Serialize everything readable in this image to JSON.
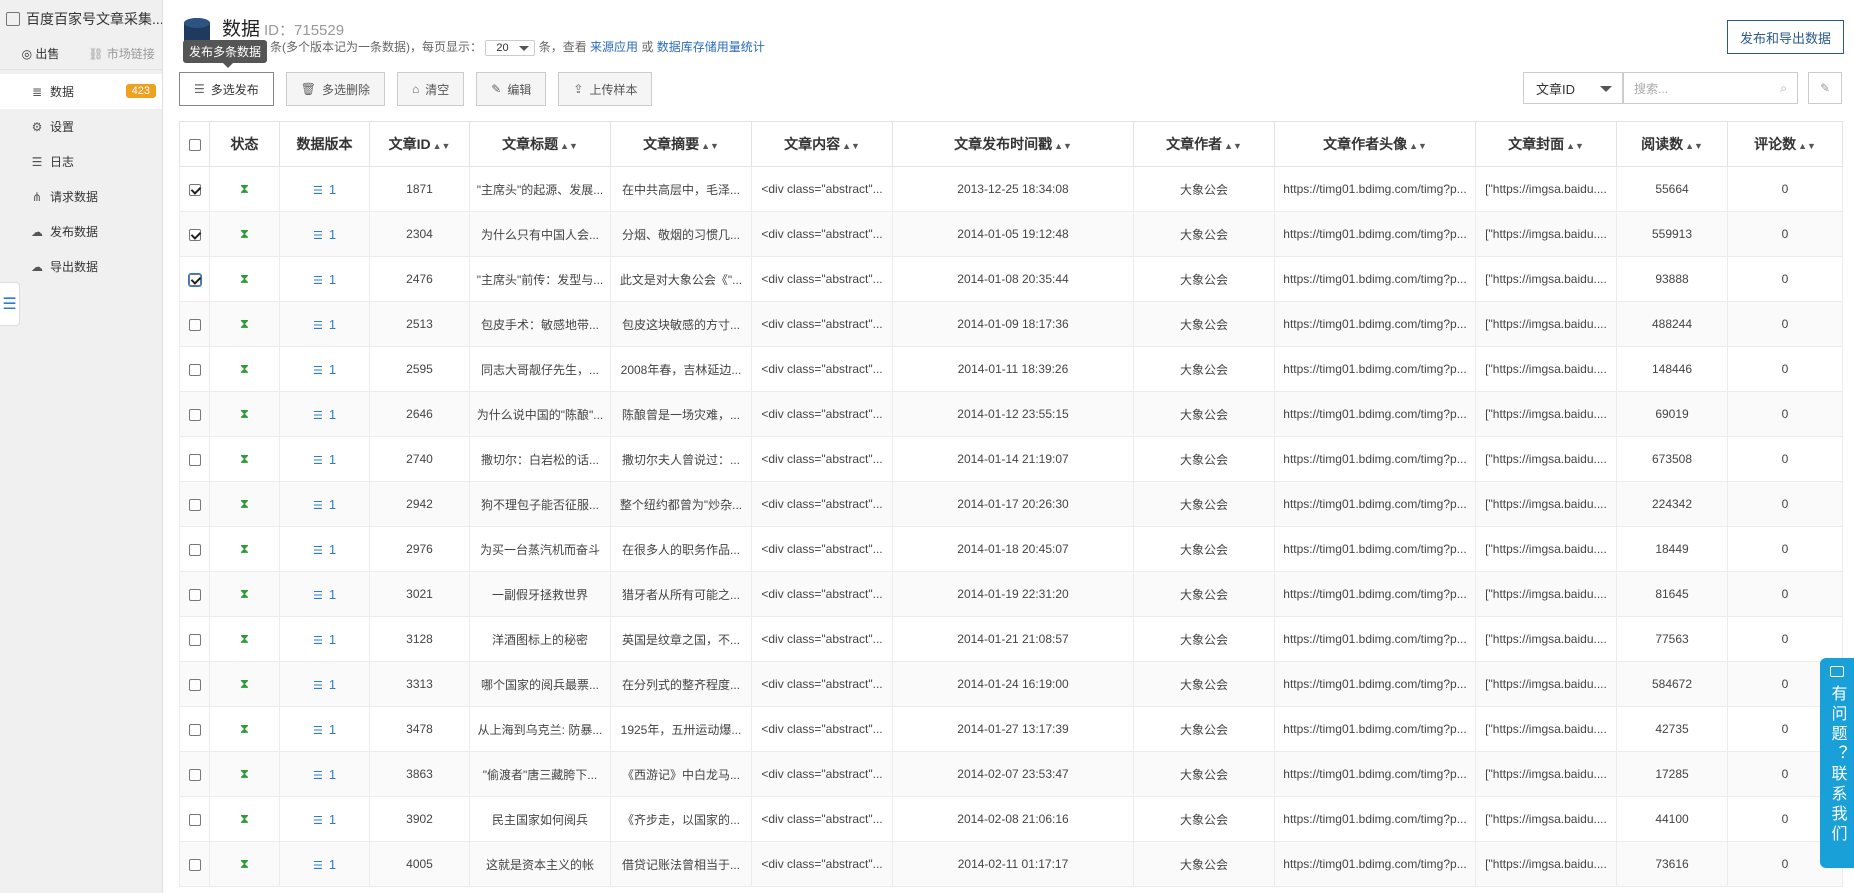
{
  "app": {
    "title": "百度百家号文章采集..."
  },
  "sidebar": {
    "tabs": [
      {
        "label": "出售"
      },
      {
        "label": "市场链接"
      }
    ],
    "items": [
      {
        "label": "数据",
        "icon": "database-icon",
        "badge": "423"
      },
      {
        "label": "设置",
        "icon": "gear-icon"
      },
      {
        "label": "日志",
        "icon": "list-icon"
      },
      {
        "label": "请求数据",
        "icon": "share-icon"
      },
      {
        "label": "发布数据",
        "icon": "cloud-upload-icon"
      },
      {
        "label": "导出数据",
        "icon": "cloud-download-icon"
      }
    ]
  },
  "header": {
    "title": "数据",
    "id_text": "ID：715529",
    "sub_prefix": "条(多个版本记为一条数据)，每页显示：",
    "page_size": "20",
    "sub_middle": "条，查看",
    "link_source": "来源应用",
    "sub_or": "或",
    "link_stats": "数据库存储用量统计",
    "tooltip": "发布多条数据",
    "publish_export": "发布和导出数据"
  },
  "toolbar": {
    "multi_publish": "多选发布",
    "multi_delete": "多选删除",
    "clear": "清空",
    "edit": "编辑",
    "upload_sample": "上传样本"
  },
  "search": {
    "field": "文章ID",
    "placeholder": "搜索..."
  },
  "table": {
    "columns": [
      "状态",
      "数据版本",
      "文章ID",
      "文章标题",
      "文章摘要",
      "文章内容",
      "文章发布时间戳",
      "文章作者",
      "文章作者头像",
      "文章封面",
      "阅读数",
      "评论数"
    ],
    "rows": [
      {
        "checked": true,
        "version": "1",
        "id": "1871",
        "title": "\"主席头\"的起源、发展...",
        "summary": "在中共高层中，毛泽...",
        "content": "<div class=\"abstract\"...",
        "time": "2013-12-25 18:34:08",
        "author": "大象公会",
        "avatar": "https://timg01.bdimg.com/timg?p...",
        "cover": "[\"https://imgsa.baidu....",
        "reads": "55664",
        "comments": "0"
      },
      {
        "checked": true,
        "version": "1",
        "id": "2304",
        "title": "为什么只有中国人会...",
        "summary": "分烟、敬烟的习惯几...",
        "content": "<div class=\"abstract\"...",
        "time": "2014-01-05 19:12:48",
        "author": "大象公会",
        "avatar": "https://timg01.bdimg.com/timg?p...",
        "cover": "[\"https://imgsa.baidu....",
        "reads": "559913",
        "comments": "0"
      },
      {
        "checked": true,
        "version": "1",
        "id": "2476",
        "title": "\"主席头\"前传：发型与...",
        "summary": "此文是对大象公会《\"...",
        "content": "<div class=\"abstract\"...",
        "time": "2014-01-08 20:35:44",
        "author": "大象公会",
        "avatar": "https://timg01.bdimg.com/timg?p...",
        "cover": "[\"https://imgsa.baidu....",
        "reads": "93888",
        "comments": "0"
      },
      {
        "checked": false,
        "version": "1",
        "id": "2513",
        "title": "包皮手术：敏感地带...",
        "summary": "包皮这块敏感的方寸...",
        "content": "<div class=\"abstract\"...",
        "time": "2014-01-09 18:17:36",
        "author": "大象公会",
        "avatar": "https://timg01.bdimg.com/timg?p...",
        "cover": "[\"https://imgsa.baidu....",
        "reads": "488244",
        "comments": "0"
      },
      {
        "checked": false,
        "version": "1",
        "id": "2595",
        "title": "同志大哥靓仔先生，...",
        "summary": "2008年春，吉林延边...",
        "content": "<div class=\"abstract\"...",
        "time": "2014-01-11 18:39:26",
        "author": "大象公会",
        "avatar": "https://timg01.bdimg.com/timg?p...",
        "cover": "[\"https://imgsa.baidu....",
        "reads": "148446",
        "comments": "0"
      },
      {
        "checked": false,
        "version": "1",
        "id": "2646",
        "title": "为什么说中国的\"陈酿\"...",
        "summary": "陈酿曾是一场灾难，...",
        "content": "<div class=\"abstract\"...",
        "time": "2014-01-12 23:55:15",
        "author": "大象公会",
        "avatar": "https://timg01.bdimg.com/timg?p...",
        "cover": "[\"https://imgsa.baidu....",
        "reads": "69019",
        "comments": "0"
      },
      {
        "checked": false,
        "version": "1",
        "id": "2740",
        "title": "撒切尔：白岩松的话...",
        "summary": "撒切尔夫人曾说过：...",
        "content": "<div class=\"abstract\"...",
        "time": "2014-01-14 21:19:07",
        "author": "大象公会",
        "avatar": "https://timg01.bdimg.com/timg?p...",
        "cover": "[\"https://imgsa.baidu....",
        "reads": "673508",
        "comments": "0"
      },
      {
        "checked": false,
        "version": "1",
        "id": "2942",
        "title": "狗不理包子能否征服...",
        "summary": "整个纽约都曾为\"炒杂...",
        "content": "<div class=\"abstract\"...",
        "time": "2014-01-17 20:26:30",
        "author": "大象公会",
        "avatar": "https://timg01.bdimg.com/timg?p...",
        "cover": "[\"https://imgsa.baidu....",
        "reads": "224342",
        "comments": "0"
      },
      {
        "checked": false,
        "version": "1",
        "id": "2976",
        "title": "为买一台蒸汽机而奋斗",
        "summary": "在很多人的职务作品...",
        "content": "<div class=\"abstract\"...",
        "time": "2014-01-18 20:45:07",
        "author": "大象公会",
        "avatar": "https://timg01.bdimg.com/timg?p...",
        "cover": "[\"https://imgsa.baidu....",
        "reads": "18449",
        "comments": "0"
      },
      {
        "checked": false,
        "version": "1",
        "id": "3021",
        "title": "一副假牙拯救世界",
        "summary": "猎牙者从所有可能之...",
        "content": "<div class=\"abstract\"...",
        "time": "2014-01-19 22:31:20",
        "author": "大象公会",
        "avatar": "https://timg01.bdimg.com/timg?p...",
        "cover": "[\"https://imgsa.baidu....",
        "reads": "81645",
        "comments": "0"
      },
      {
        "checked": false,
        "version": "1",
        "id": "3128",
        "title": "洋酒图标上的秘密",
        "summary": "英国是纹章之国，不...",
        "content": "<div class=\"abstract\"...",
        "time": "2014-01-21 21:08:57",
        "author": "大象公会",
        "avatar": "https://timg01.bdimg.com/timg?p...",
        "cover": "[\"https://imgsa.baidu....",
        "reads": "77563",
        "comments": "0"
      },
      {
        "checked": false,
        "version": "1",
        "id": "3313",
        "title": "哪个国家的阅兵最票...",
        "summary": "在分列式的整齐程度...",
        "content": "<div class=\"abstract\"...",
        "time": "2014-01-24 16:19:00",
        "author": "大象公会",
        "avatar": "https://timg01.bdimg.com/timg?p...",
        "cover": "[\"https://imgsa.baidu....",
        "reads": "584672",
        "comments": "0"
      },
      {
        "checked": false,
        "version": "1",
        "id": "3478",
        "title": "从上海到乌克兰: 防暴...",
        "summary": "1925年，五卅运动爆...",
        "content": "<div class=\"abstract\"...",
        "time": "2014-01-27 13:17:39",
        "author": "大象公会",
        "avatar": "https://timg01.bdimg.com/timg?p...",
        "cover": "[\"https://imgsa.baidu....",
        "reads": "42735",
        "comments": "0"
      },
      {
        "checked": false,
        "version": "1",
        "id": "3863",
        "title": "\"偷渡者\"唐三藏胯下...",
        "summary": "《西游记》中白龙马...",
        "content": "<div class=\"abstract\"...",
        "time": "2014-02-07 23:53:47",
        "author": "大象公会",
        "avatar": "https://timg01.bdimg.com/timg?p...",
        "cover": "[\"https://imgsa.baidu....",
        "reads": "17285",
        "comments": "0"
      },
      {
        "checked": false,
        "version": "1",
        "id": "3902",
        "title": "民主国家如何阅兵",
        "summary": "《齐步走，以国家的...",
        "content": "<div class=\"abstract\"...",
        "time": "2014-02-08 21:06:16",
        "author": "大象公会",
        "avatar": "https://timg01.bdimg.com/timg?p...",
        "cover": "[\"https://imgsa.baidu....",
        "reads": "44100",
        "comments": "0"
      },
      {
        "checked": false,
        "version": "1",
        "id": "4005",
        "title": "这就是资本主义的帐",
        "summary": "借贷记账法曾相当于...",
        "content": "<div class=\"abstract\"...",
        "time": "2014-02-11 01:17:17",
        "author": "大象公会",
        "avatar": "https://timg01.bdimg.com/timg?p...",
        "cover": "[\"https://imgsa.baidu....",
        "reads": "73616",
        "comments": "0"
      }
    ]
  },
  "help": {
    "text": "有问题？联系我们"
  }
}
